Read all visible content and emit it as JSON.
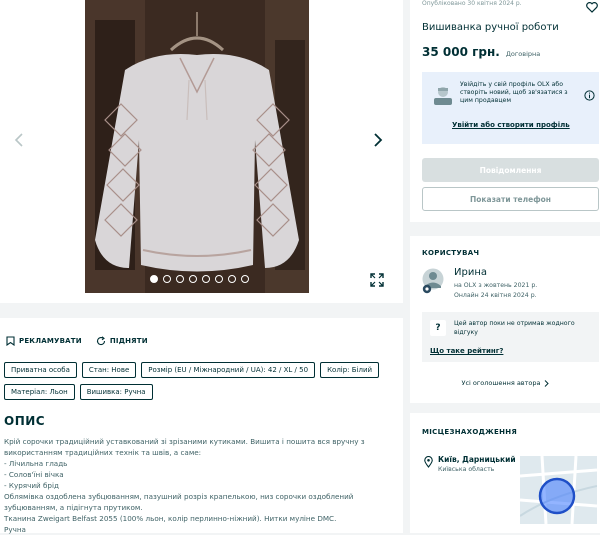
{
  "gallery": {
    "dots_total": 8,
    "dots_active_index": 0
  },
  "actions": {
    "promote": "РЕКЛАМУВАТИ",
    "raise": "ПІДНЯТИ"
  },
  "tags": [
    "Приватна особа",
    "Стан: Нове",
    "Розмір (EU / Міжнародний / UA): 42 / XL / 50",
    "Колір: Білий",
    "Матеріал: Льон",
    "Вишивка: Ручна"
  ],
  "description": {
    "heading": "ОПИС",
    "lines": [
      "Крій сорочки традиційний уставкований зі зрізаними кутиками. Вишита і пошита вся вручну з",
      "використанням традиційних технік та швів, а саме:",
      "- Лічильна гладь",
      "- Солов'їні вічка",
      "- Курячий брід",
      "Облямівка оздоблена зубцюванням, пазушний розріз крапелькою, низ сорочки оздоблений",
      "зубцюванням, а підігнута прутиком.",
      "Тканина Zweigart Belfast 2055 (100% льон, колір перлинно-ніжний). Нитки муліне DMC.",
      "Ручна"
    ]
  },
  "listing": {
    "published": "Опубліковано 30 квітня 2024 р.",
    "title": "Вишиванка ручної роботи",
    "price": "35 000 грн.",
    "negotiable": "Договірна",
    "login_prompt": "Увійдіть у свій профіль OLX або створіть новий, щоб зв'язатися з цим продавцем",
    "login_link": "Увійти або створити профіль",
    "message_button": "Повідомлення",
    "phone_button": "Показати телефон"
  },
  "user": {
    "section_title": "КОРИСТУВАЧ",
    "name": "Ирина",
    "since": "на OLX з жовтень 2021 р.",
    "online": "Онлайн 24 квітня 2024 р.",
    "rating_text": "Цей автор поки не отримав жодного відгуку",
    "rating_link": "Що таке рейтинг?",
    "all_ads": "Усі оголошення автора"
  },
  "location": {
    "section_title": "МІСЦЕЗНАХОДЖЕННЯ",
    "city": "Київ, Дарницький",
    "region": "Київська область"
  },
  "colors": {
    "brand_dark": "#002f34",
    "accent_teal": "#23e5db",
    "login_bg": "#e8f0fb",
    "disabled_btn": "#d8dfe0",
    "map_circle": "#3a77ff"
  }
}
